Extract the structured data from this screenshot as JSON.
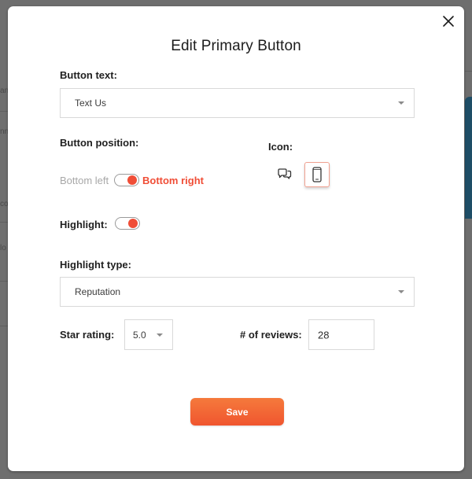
{
  "modal": {
    "title": "Edit Primary Button",
    "close_icon": "close-icon"
  },
  "button_text": {
    "label": "Button text:",
    "value": "Text Us"
  },
  "button_position": {
    "label": "Button position:",
    "left_option": "Bottom left",
    "right_option": "Bottom right",
    "selected": "Bottom right"
  },
  "icon": {
    "label": "Icon:",
    "options": [
      {
        "name": "chat-bubbles-icon",
        "selected": false
      },
      {
        "name": "mobile-phone-icon",
        "selected": true
      }
    ]
  },
  "highlight": {
    "label": "Highlight:",
    "enabled": true
  },
  "highlight_type": {
    "label": "Highlight type:",
    "value": "Reputation"
  },
  "star_rating": {
    "label": "Star rating:",
    "value": "5.0"
  },
  "reviews": {
    "label": "# of reviews:",
    "value": "28"
  },
  "save_label": "Save",
  "backdrop": {
    "fragments": [
      "an",
      "nn",
      "co",
      "lo"
    ]
  },
  "colors": {
    "accent": "#f04e37",
    "save_gradient_top": "#f57a3c",
    "save_gradient_bottom": "#f0552f",
    "overlay": "#6e6e6e",
    "backdrop_card": "#1e4d66"
  }
}
